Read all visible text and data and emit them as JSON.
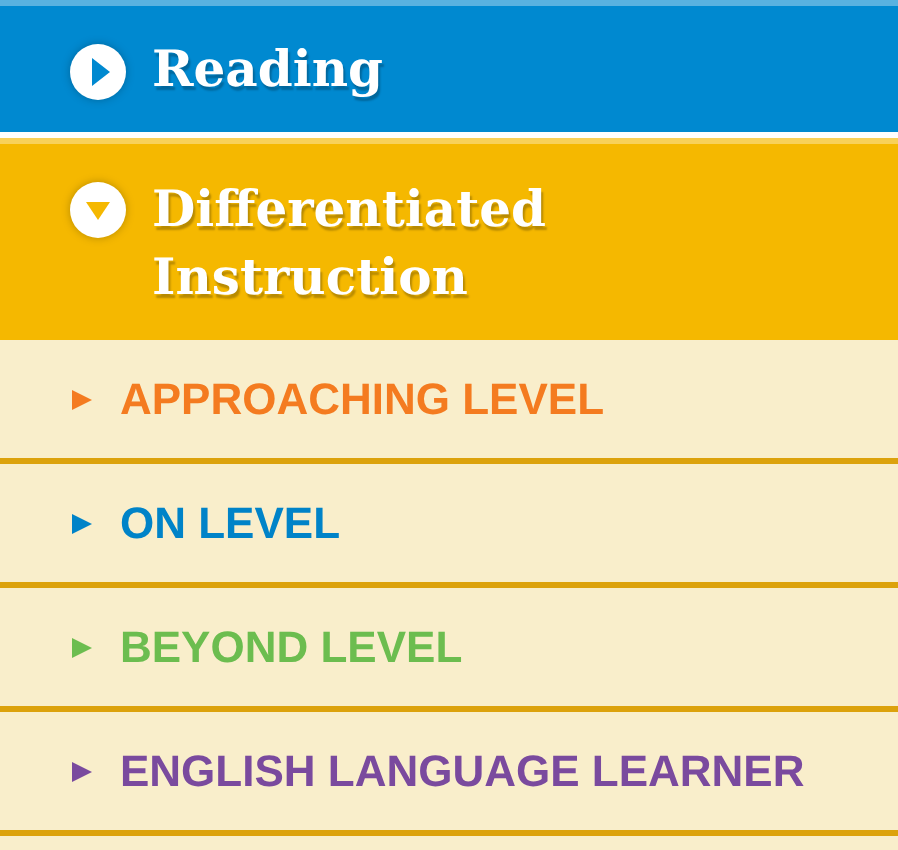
{
  "sections": [
    {
      "title": "Reading",
      "expanded": false,
      "color": "#0089d0"
    },
    {
      "title": "Differentiated Instruction",
      "expanded": true,
      "color": "#f5b800",
      "items": [
        {
          "label": "APPROACHING LEVEL",
          "color": "#f47b20"
        },
        {
          "label": "ON LEVEL",
          "color": "#0083c8"
        },
        {
          "label": "BEYOND LEVEL",
          "color": "#6cbd4f"
        },
        {
          "label": "ENGLISH LANGUAGE LEARNER",
          "color": "#7a4a9e"
        }
      ]
    }
  ]
}
